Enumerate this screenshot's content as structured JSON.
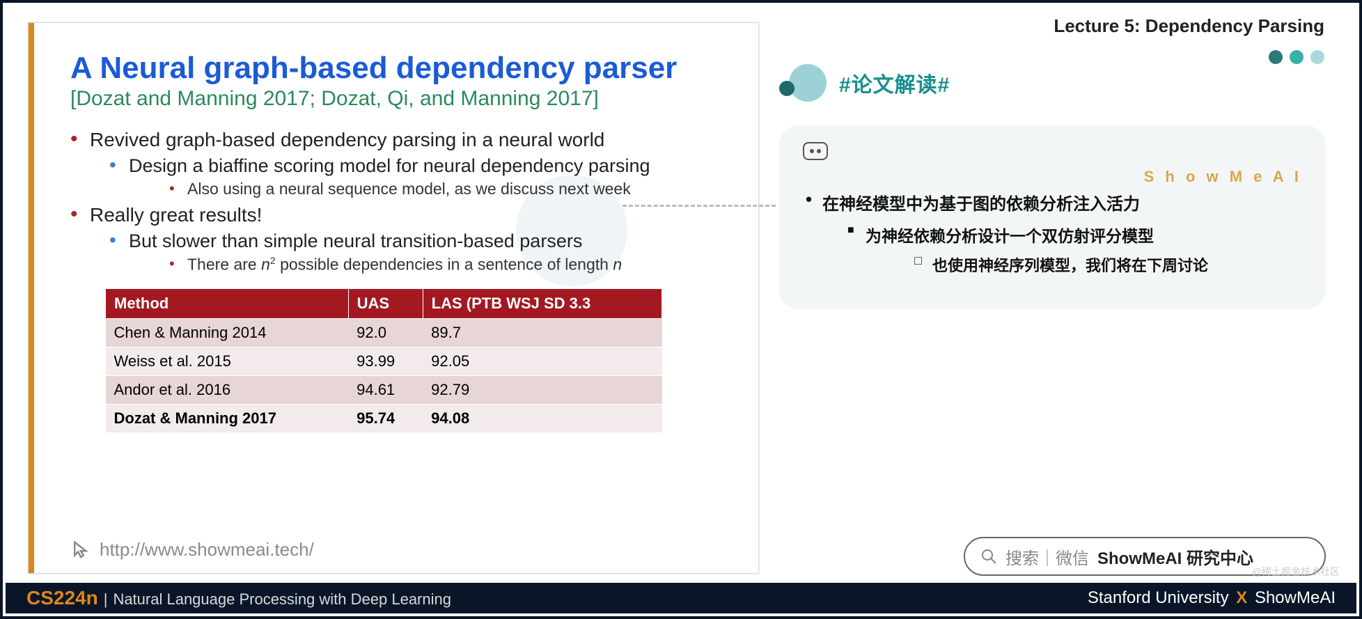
{
  "header": {
    "lecture": "Lecture 5:  Dependency Parsing"
  },
  "slide": {
    "title": "A Neural graph-based dependency parser",
    "citation": "[Dozat and Manning 2017; Dozat, Qi, and Manning 2017]",
    "bullets": {
      "b1": "Revived graph-based dependency parsing in a neural world",
      "b1_1": "Design a biaffine scoring model for neural dependency parsing",
      "b1_1_1": "Also using a neural sequence model, as we discuss next week",
      "b2": "Really great results!",
      "b2_1": "But slower than simple neural transition-based parsers",
      "b2_1_1_prefix": "There are ",
      "b2_1_1_mid": " possible dependencies in a sentence of length ",
      "n_var": "n",
      "n_exp": "2"
    },
    "table": {
      "headers": {
        "c1": "Method",
        "c2": "UAS",
        "c3": "LAS (PTB WSJ SD 3.3"
      },
      "rows": [
        {
          "method": "Chen & Manning 2014",
          "uas": "92.0",
          "las": "89.7"
        },
        {
          "method": "Weiss et al. 2015",
          "uas": "93.99",
          "las": "92.05"
        },
        {
          "method": "Andor et al. 2016",
          "uas": "94.61",
          "las": "92.79"
        },
        {
          "method": "Dozat & Manning 2017",
          "uas": "95.74",
          "las": "94.08"
        }
      ]
    },
    "footer_link": "http://www.showmeai.tech/"
  },
  "annotation": {
    "tag": "#论文解读#",
    "brand": "S h o w M e A I",
    "lines": {
      "l1": "在神经模型中为基于图的依赖分析注入活力",
      "l2": "为神经依赖分析设计一个双仿射评分模型",
      "l3": "也使用神经序列模型，我们将在下周讨论"
    }
  },
  "search": {
    "prefix": "搜索｜微信",
    "bold": "ShowMeAI 研究中心"
  },
  "watermark": "@稀土掘金技术社区",
  "footer": {
    "course": "CS224n",
    "sep": " | ",
    "subtitle": "Natural Language Processing with Deep Learning",
    "uni": "Stanford University",
    "x": "X",
    "brand": "ShowMeAI"
  },
  "chart_data": {
    "type": "table",
    "title": "A Neural graph-based dependency parser — results (PTB WSJ SD 3.3)",
    "columns": [
      "Method",
      "UAS",
      "LAS"
    ],
    "rows": [
      [
        "Chen & Manning 2014",
        92.0,
        89.7
      ],
      [
        "Weiss et al. 2015",
        93.99,
        92.05
      ],
      [
        "Andor et al. 2016",
        94.61,
        92.79
      ],
      [
        "Dozat & Manning 2017",
        95.74,
        94.08
      ]
    ]
  }
}
